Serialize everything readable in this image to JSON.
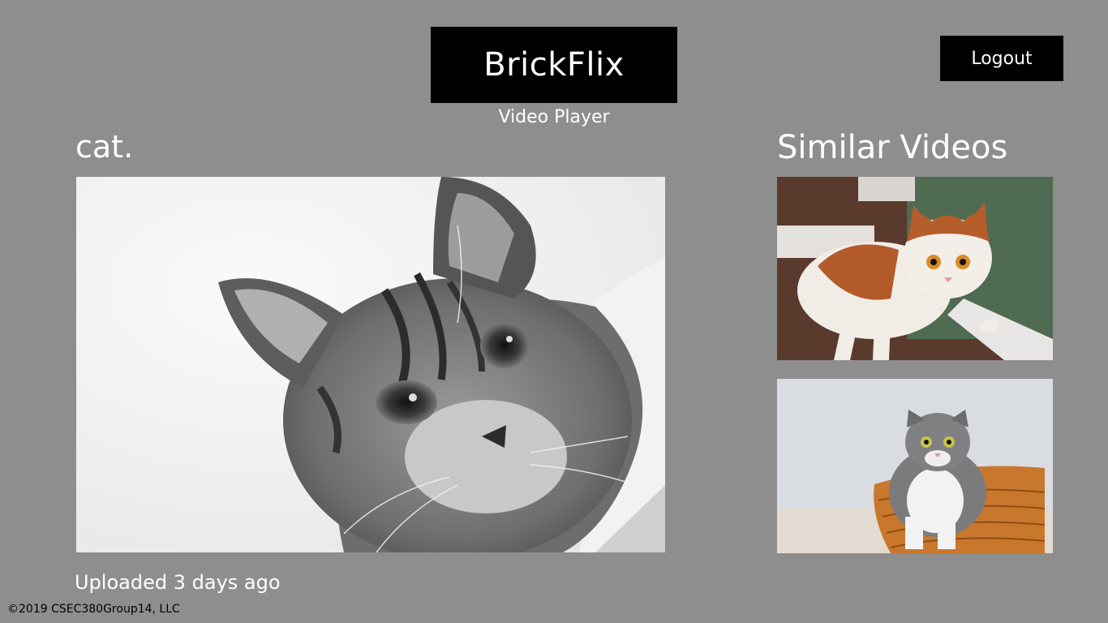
{
  "header": {
    "brand": "BrickFlix",
    "subtitle": "Video Player",
    "logout_label": "Logout"
  },
  "video": {
    "title": "cat.",
    "upload_info": "Uploaded 3 days ago"
  },
  "similar": {
    "heading": "Similar Videos",
    "items": [
      {
        "thumbnail": "calico-cat-on-windowsill"
      },
      {
        "thumbnail": "tabby-cat-in-wicker-basket"
      }
    ]
  },
  "footer": {
    "copyright": "©2019 CSEC380Group14, LLC"
  },
  "colors": {
    "background": "#8e8e8e",
    "header_box": "#000000",
    "text": "#ffffff",
    "footer_text": "#000000"
  }
}
